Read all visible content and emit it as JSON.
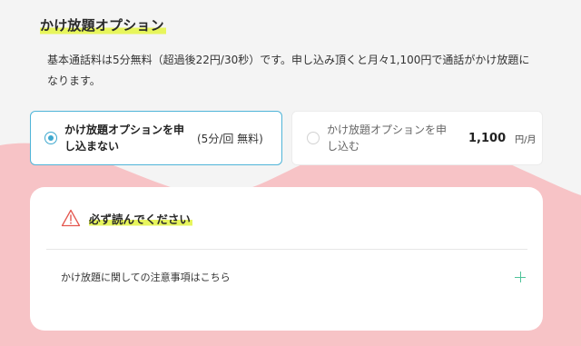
{
  "colors": {
    "accent_blue": "#3ea8cf",
    "highlight_yellow": "#e7f55c",
    "wave_pink": "#f7c3c6",
    "warning_red": "#e4574f",
    "plus_green": "#4fc39a"
  },
  "section": {
    "title": "かけ放題オプション",
    "description": "基本通話料は5分無料（超過後22円/30秒）です。申し込み頂くと月々1,100円で通話がかけ放題になります。"
  },
  "options": [
    {
      "label": "かけ放題オプションを申し込まない",
      "meta": "(5分/回 無料)",
      "selected": true
    },
    {
      "label": "かけ放題オプションを申し込む",
      "price": "1,100",
      "unit": "円/月",
      "selected": false
    }
  ],
  "notice": {
    "icon": "warning-triangle-icon",
    "title": "必ず読んでください",
    "accordion_label": "かけ放題に関しての注意事項はこちら",
    "accordion_icon": "plus-icon"
  }
}
